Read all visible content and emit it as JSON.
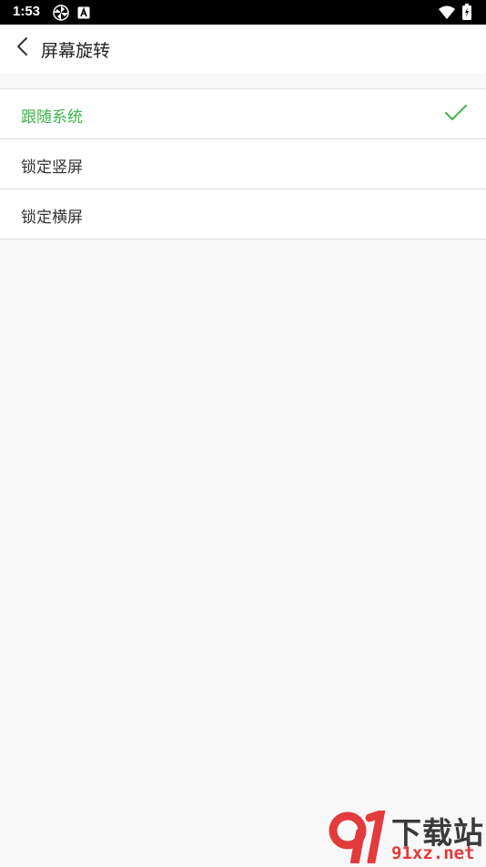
{
  "status_bar": {
    "time": "1:53",
    "icons": [
      "pinwheel-icon",
      "a-notification-icon",
      "wifi-icon",
      "battery-charging-icon"
    ]
  },
  "header": {
    "back_icon": "chevron-left-icon",
    "title": "屏幕旋转"
  },
  "options": [
    {
      "label": "跟随系统",
      "selected": true
    },
    {
      "label": "锁定竖屏",
      "selected": false
    },
    {
      "label": "锁定横屏",
      "selected": false
    }
  ],
  "watermark": {
    "cn_text": "下载站",
    "en_text": "91xz.net"
  },
  "colors": {
    "accent": "#3ab64a",
    "watermark_red": "#e23b3b",
    "background": "#f8f8f8"
  }
}
